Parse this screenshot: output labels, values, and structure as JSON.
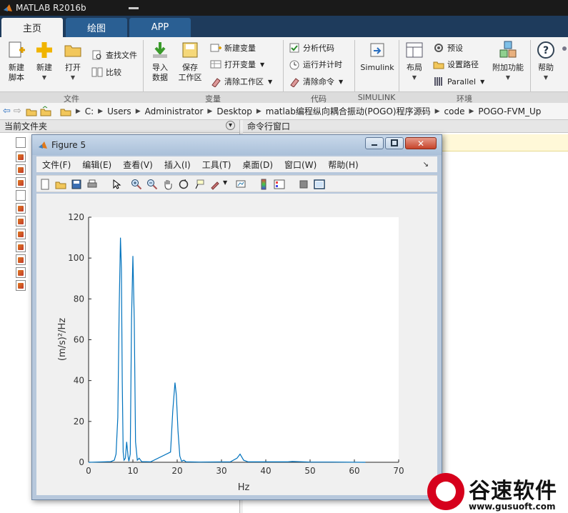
{
  "app": {
    "title": "MATLAB R2016b"
  },
  "tabs": [
    "主页",
    "绘图",
    "APP"
  ],
  "ribbon": {
    "file": {
      "new_script": "新建\n脚本",
      "new": "新建",
      "open": "打开",
      "find_files": "查找文件",
      "compare": "比较",
      "label": "文件"
    },
    "variable": {
      "import": "导入\n数据",
      "save_workspace": "保存\n工作区",
      "new_variable": "新建变量",
      "open_variable": "打开变量",
      "clear_workspace": "清除工作区",
      "label": "变量"
    },
    "code": {
      "analyze": "分析代码",
      "run_and_time": "运行并计时",
      "clear_commands": "清除命令",
      "label": "代码"
    },
    "simulink": {
      "simulink": "Simulink",
      "label": "SIMULINK"
    },
    "env": {
      "layout": "布局",
      "preferences": "预设",
      "set_path": "设置路径",
      "parallel": "Parallel",
      "addons": "附加功能",
      "label": "环境"
    },
    "help": {
      "help": "帮助"
    }
  },
  "address": [
    "C:",
    "Users",
    "Administrator",
    "Desktop",
    "matlab编程纵向耦合振动(POGO)程序源码",
    "code",
    "POGO-FVM_Up"
  ],
  "panels": {
    "current_folder": "当前文件夹",
    "command_window": "命令行窗口"
  },
  "figure": {
    "title": "Figure 5",
    "menu": [
      "文件(F)",
      "编辑(E)",
      "查看(V)",
      "插入(I)",
      "工具(T)",
      "桌面(D)",
      "窗口(W)",
      "帮助(H)"
    ]
  },
  "chart_data": {
    "type": "line",
    "title": "",
    "xlabel": "Hz",
    "ylabel": "(m/s)²/Hz",
    "xlim": [
      0,
      70
    ],
    "ylim": [
      0,
      120
    ],
    "xticks": [
      0,
      10,
      20,
      30,
      40,
      50,
      60,
      70
    ],
    "yticks": [
      0,
      20,
      40,
      60,
      80,
      100,
      120
    ],
    "grid": false,
    "color": "#0072bd",
    "series": [
      {
        "x": [
          0,
          5,
          5.8,
          6.2,
          6.6,
          6.9,
          7.2,
          7.4,
          7.6,
          7.8,
          8.0,
          8.3,
          8.6,
          8.9,
          9.1,
          9.4,
          9.7,
          10.0,
          10.3,
          10.6,
          11.0,
          11.4,
          12,
          14,
          18.5,
          19.0,
          19.5,
          19.8,
          20.2,
          20.6,
          21.0,
          21.5,
          22,
          25,
          32,
          33.5,
          34.2,
          35.0,
          36,
          45,
          46,
          50,
          55,
          62.5
        ],
        "y": [
          0,
          0.3,
          1,
          4,
          22,
          75,
          110,
          95,
          40,
          5,
          1,
          2,
          10,
          3,
          0.5,
          4,
          70,
          101,
          70,
          10,
          1,
          2,
          0.3,
          0.2,
          5,
          25,
          39,
          33,
          15,
          3,
          0.5,
          1,
          0.2,
          0.1,
          0.2,
          2,
          4,
          1,
          0.2,
          0.2,
          0.4,
          0.1,
          0.1,
          0
        ]
      }
    ]
  },
  "watermark": {
    "brand": "谷速软件",
    "url": "www.gusuoft.com"
  }
}
